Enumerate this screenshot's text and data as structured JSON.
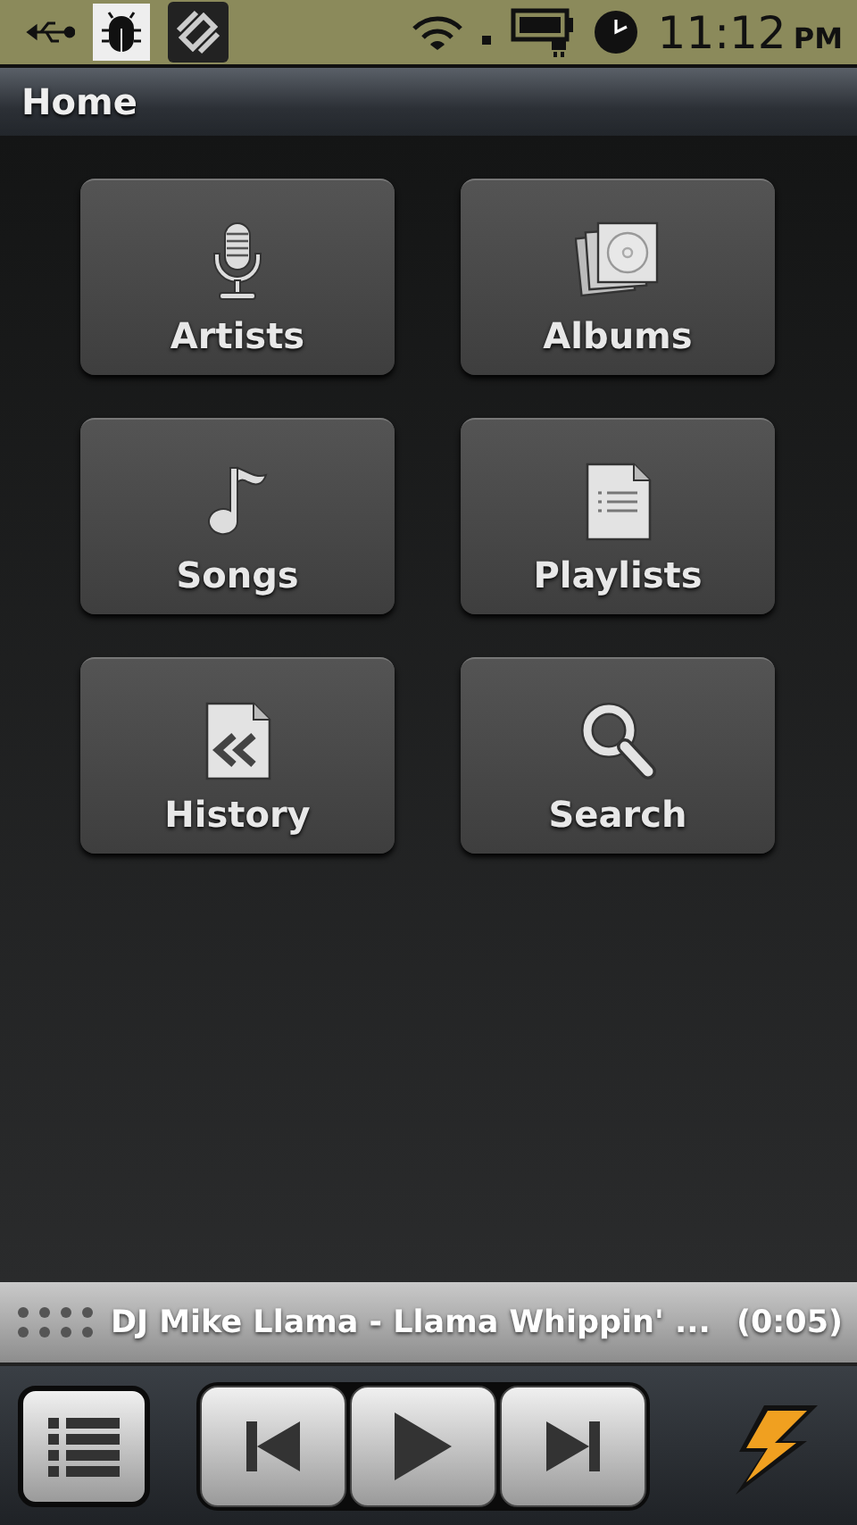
{
  "status_bar": {
    "time": "11:12",
    "meridiem": "PM"
  },
  "title_bar": {
    "title": "Home"
  },
  "tiles": [
    {
      "label": "Artists"
    },
    {
      "label": "Albums"
    },
    {
      "label": "Songs"
    },
    {
      "label": "Playlists"
    },
    {
      "label": "History"
    },
    {
      "label": "Search"
    }
  ],
  "now_playing": {
    "track": "DJ Mike Llama - Llama Whippin' ...",
    "time": "(0:05)"
  }
}
